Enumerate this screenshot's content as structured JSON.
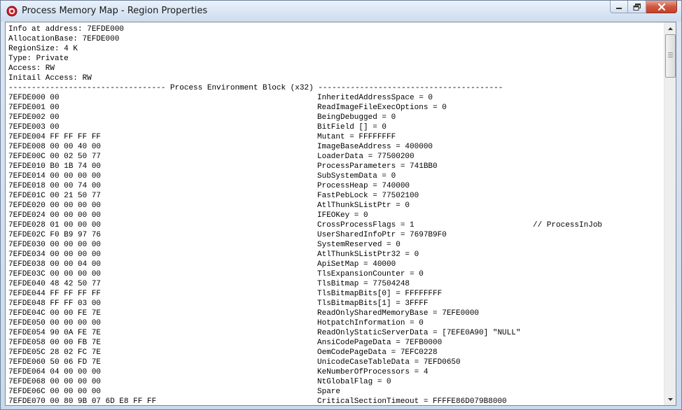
{
  "window": {
    "title": "Process Memory Map - Region Properties",
    "icon": "app-record-icon",
    "controls": [
      "minimize-icon",
      "restore-icon",
      "close-icon"
    ]
  },
  "info_lines": [
    "Info at address: 7EFDE000",
    "AllocationBase: 7EFDE000",
    "RegionSize: 4 K",
    "Type: Private",
    "Access: RW",
    "Initail Access: RW"
  ],
  "separator": "---------------------------------- Process Environment Block (x32) ----------------------------------------",
  "peb_rows": [
    {
      "hex": "7EFDE000 00",
      "field": "InheritedAddressSpace = 0",
      "comment": ""
    },
    {
      "hex": "7EFDE001 00",
      "field": "ReadImageFileExecOptions = 0",
      "comment": ""
    },
    {
      "hex": "7EFDE002 00",
      "field": "BeingDebugged = 0",
      "comment": ""
    },
    {
      "hex": "7EFDE003 00",
      "field": "BitField [] = 0",
      "comment": ""
    },
    {
      "hex": "7EFDE004 FF FF FF FF",
      "field": "Mutant = FFFFFFFF",
      "comment": ""
    },
    {
      "hex": "7EFDE008 00 00 40 00",
      "field": "ImageBaseAddress = 400000",
      "comment": ""
    },
    {
      "hex": "7EFDE00C 00 02 50 77",
      "field": "LoaderData = 77500200",
      "comment": ""
    },
    {
      "hex": "7EFDE010 B0 1B 74 00",
      "field": "ProcessParameters = 741BB0",
      "comment": ""
    },
    {
      "hex": "7EFDE014 00 00 00 00",
      "field": "SubSystemData = 0",
      "comment": ""
    },
    {
      "hex": "7EFDE018 00 00 74 00",
      "field": "ProcessHeap = 740000",
      "comment": ""
    },
    {
      "hex": "7EFDE01C 00 21 50 77",
      "field": "FastPebLock = 77502100",
      "comment": ""
    },
    {
      "hex": "7EFDE020 00 00 00 00",
      "field": "AtlThunkSListPtr = 0",
      "comment": ""
    },
    {
      "hex": "7EFDE024 00 00 00 00",
      "field": "IFEOKey = 0",
      "comment": ""
    },
    {
      "hex": "7EFDE028 01 00 00 00",
      "field": "CrossProcessFlags = 1",
      "comment": "// ProcessInJob"
    },
    {
      "hex": "7EFDE02C F0 B9 97 76",
      "field": "UserSharedInfoPtr = 7697B9F0",
      "comment": ""
    },
    {
      "hex": "7EFDE030 00 00 00 00",
      "field": "SystemReserved = 0",
      "comment": ""
    },
    {
      "hex": "7EFDE034 00 00 00 00",
      "field": "AtlThunkSListPtr32 = 0",
      "comment": ""
    },
    {
      "hex": "7EFDE038 00 00 04 00",
      "field": "ApiSetMap = 40000",
      "comment": ""
    },
    {
      "hex": "7EFDE03C 00 00 00 00",
      "field": "TlsExpansionCounter = 0",
      "comment": ""
    },
    {
      "hex": "7EFDE040 48 42 50 77",
      "field": "TlsBitmap = 77504248",
      "comment": ""
    },
    {
      "hex": "7EFDE044 FF FF FF FF",
      "field": "TlsBitmapBits[0] = FFFFFFFF",
      "comment": ""
    },
    {
      "hex": "7EFDE048 FF FF 03 00",
      "field": "TlsBitmapBits[1] = 3FFFF",
      "comment": ""
    },
    {
      "hex": "7EFDE04C 00 00 FE 7E",
      "field": "ReadOnlySharedMemoryBase = 7EFE0000",
      "comment": ""
    },
    {
      "hex": "7EFDE050 00 00 00 00",
      "field": "HotpatchInformation = 0",
      "comment": ""
    },
    {
      "hex": "7EFDE054 90 0A FE 7E",
      "field": "ReadOnlyStaticServerData = [7EFE0A90] \"NULL\"",
      "comment": ""
    },
    {
      "hex": "7EFDE058 00 00 FB 7E",
      "field": "AnsiCodePageData = 7EFB0000",
      "comment": ""
    },
    {
      "hex": "7EFDE05C 28 02 FC 7E",
      "field": "OemCodePageData = 7EFC0228",
      "comment": ""
    },
    {
      "hex": "7EFDE060 50 06 FD 7E",
      "field": "UnicodeCaseTableData = 7EFD0650",
      "comment": ""
    },
    {
      "hex": "7EFDE064 04 00 00 00",
      "field": "KeNumberOfProcessors = 4",
      "comment": ""
    },
    {
      "hex": "7EFDE068 00 00 00 00",
      "field": "NtGlobalFlag = 0",
      "comment": ""
    },
    {
      "hex": "7EFDE06C 00 00 00 00",
      "field": "Spare",
      "comment": ""
    },
    {
      "hex": "7EFDE070 00 80 9B 07 6D E8 FF FF",
      "field": "CriticalSectionTimeout = FFFFE86D079B8000",
      "comment": ""
    }
  ],
  "scrollbar": {
    "up": "scroll-up-arrow-icon",
    "down": "scroll-down-arrow-icon"
  }
}
